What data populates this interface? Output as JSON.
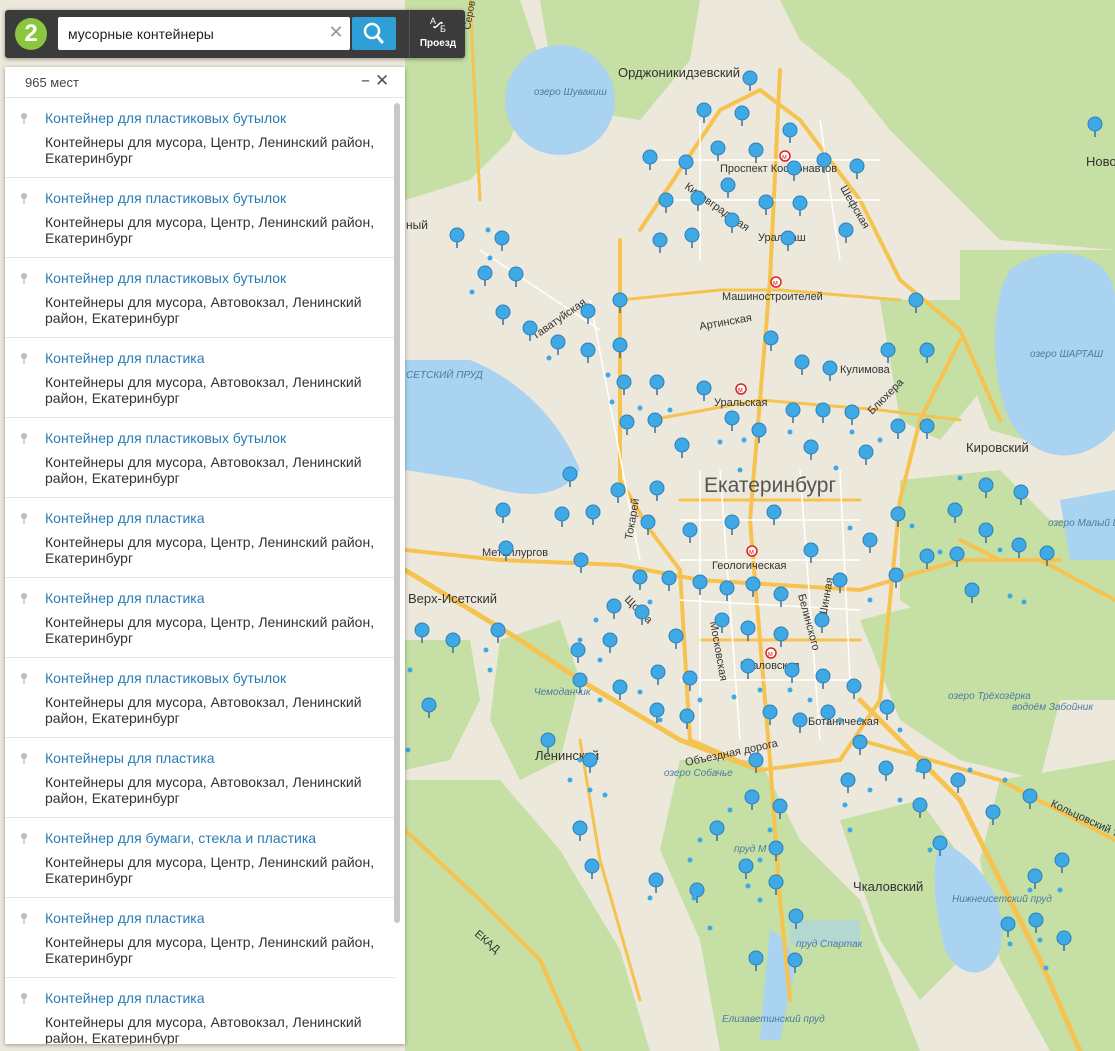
{
  "search": {
    "value": "мусорные контейнеры",
    "clear_icon": "close-icon",
    "search_icon": "search-icon"
  },
  "logo": {
    "text": "2"
  },
  "route": {
    "label": "Проезд",
    "icon": "route-icon"
  },
  "results": {
    "count": "965 мест",
    "items": [
      {
        "title": "Контейнер для пластиковых бутылок",
        "sub": "Контейнеры для мусора, Центр, Ленинский район, Екатеринбург"
      },
      {
        "title": "Контейнер для пластиковых бутылок",
        "sub": "Контейнеры для мусора, Центр, Ленинский район, Екатеринбург"
      },
      {
        "title": "Контейнер для пластиковых бутылок",
        "sub": "Контейнеры для мусора, Автовокзал, Ленинский район, Екатеринбург"
      },
      {
        "title": "Контейнер для пластика",
        "sub": "Контейнеры для мусора, Автовокзал, Ленинский район, Екатеринбург"
      },
      {
        "title": "Контейнер для пластиковых бутылок",
        "sub": "Контейнеры для мусора, Автовокзал, Ленинский район, Екатеринбург"
      },
      {
        "title": "Контейнер для пластика",
        "sub": "Контейнеры для мусора, Центр, Ленинский район, Екатеринбург"
      },
      {
        "title": "Контейнер для пластика",
        "sub": "Контейнеры для мусора, Центр, Ленинский район, Екатеринбург"
      },
      {
        "title": "Контейнер для пластиковых бутылок",
        "sub": "Контейнеры для мусора, Автовокзал, Ленинский район, Екатеринбург"
      },
      {
        "title": "Контейнеры для пластика",
        "sub": "Контейнеры для мусора, Автовокзал, Ленинский район, Екатеринбург"
      },
      {
        "title": "Контейнер для бумаги, стекла и пластика",
        "sub": "Контейнеры для мусора, Центр, Ленинский район, Екатеринбург"
      },
      {
        "title": "Контейнер для пластика",
        "sub": "Контейнеры для мусора, Центр, Ленинский район, Екатеринбург"
      },
      {
        "title": "Контейнер для пластика",
        "sub": "Контейнеры для мусора, Автовокзал, Ленинский район, Екатеринбург"
      }
    ]
  },
  "map": {
    "colors": {
      "land": "#ede8dc",
      "forest": "#c5dfa4",
      "water": "#a9d3f0",
      "road": "#f6c350",
      "pin": "#3fa9e6"
    },
    "labels": {
      "ordzhonikidzevsky": "Орджоникидзевский",
      "lake_shuvakish": "озеро Шувакиш",
      "prospekt_kosmonavtov": "Проспект Космонавтов",
      "kirovgradskaya": "Кировградская",
      "shefskaya": "Шефская",
      "uralmash": "Уралмаш",
      "mashinostroiteley": "Машиностроителей",
      "artinskaya": "Артинская",
      "tavatuyskaya": "Таватуйская",
      "kulimova": "Кулимова",
      "blyukhera": "Блюхера",
      "uralskaya": "Уральская",
      "lake_shartash": "озеро ШАРТАШ",
      "kirovsky": "Кировский",
      "ekaterinburg": "Екатеринбург",
      "tokarey": "Токарей",
      "metallurgov": "Металлургов",
      "geologicheskaya": "Геологическая",
      "verkh_isetsky": "Верх-Исетский",
      "shchorsa": "Щорса",
      "moskovskaya": "Московская",
      "belinskogo": "Белинского",
      "shchinnaya": "Шинная",
      "chkalovskaya": "Чкаловская",
      "botanicheskaya": "Ботаническая",
      "chemodanchik": "Чемоданчик",
      "leninsky": "Ленинский",
      "obezdnaya": "Объездная дорога",
      "lake_sobachye": "озеро Собачье",
      "lake_trekhozerka": "озеро Трёхозёрка",
      "vodoem_zaboyniki": "водоём Забойник",
      "koltsovsky_trakt": "Кольцовский тракт",
      "prud_m": "пруд М",
      "chkalovsky": "Чкаловский",
      "nizhneisetsky_prud": "Нижнеисетский пруд",
      "ekad": "ЕКАД",
      "prud_spartak": "пруд Спартак",
      "elizavetinsky_prud": "Елизаветинский пруд",
      "setsky_prud": "СЕТСКИЙ ПРУД",
      "maly_shartash": "озеро Малый Шарташ",
      "novo": "Ново",
      "nyy": "ный",
      "serov": "Серов"
    }
  }
}
